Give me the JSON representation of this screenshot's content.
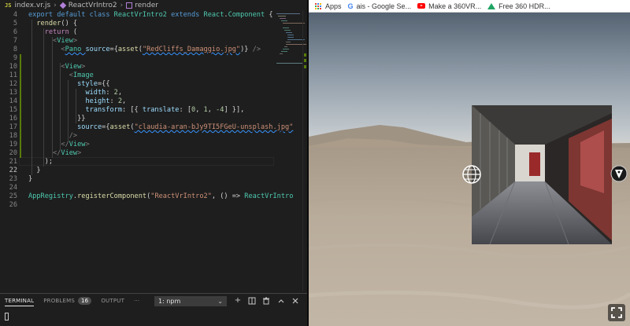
{
  "editor": {
    "breadcrumb": {
      "file_badge": "JS",
      "file_name": "index.vr.js",
      "class_name": "ReactVrIntro2",
      "method_name": "render",
      "separator": "›"
    },
    "lines": [
      {
        "num": "4",
        "tokens": [
          [
            "kw",
            "export "
          ],
          [
            "kw",
            "default "
          ],
          [
            "kw",
            "class "
          ],
          [
            "cls",
            "ReactVrIntro2 "
          ],
          [
            "kw",
            "extends "
          ],
          [
            "cls",
            "React"
          ],
          [
            "txt",
            "."
          ],
          [
            "cls",
            "Component "
          ],
          [
            "txt",
            "{"
          ]
        ]
      },
      {
        "num": "5",
        "tokens": [
          [
            "txt",
            "  "
          ],
          [
            "fn",
            "render"
          ],
          [
            "txt",
            "() {"
          ]
        ]
      },
      {
        "num": "6",
        "tokens": [
          [
            "txt",
            "    "
          ],
          [
            "ctl",
            "return "
          ],
          [
            "txt",
            "("
          ]
        ]
      },
      {
        "num": "7",
        "tokens": [
          [
            "txt",
            "      "
          ],
          [
            "punc",
            "<"
          ],
          [
            "tag",
            "View"
          ],
          [
            "punc",
            ">"
          ]
        ]
      },
      {
        "num": "8",
        "tokens": [
          [
            "txt",
            "        "
          ],
          [
            "punc",
            "<"
          ],
          [
            "tag",
            "Pano "
          ],
          [
            "prop",
            "source"
          ],
          [
            "txt",
            "={"
          ],
          [
            "fn",
            "asset"
          ],
          [
            "txt",
            "("
          ],
          [
            "str",
            "\"RedCliffs_Damaggio.jpg\""
          ],
          [
            "txt",
            ")} "
          ],
          [
            "punc",
            "/>"
          ]
        ]
      },
      {
        "num": "9",
        "tokens": []
      },
      {
        "num": "10",
        "tokens": [
          [
            "txt",
            "        "
          ],
          [
            "punc",
            "<"
          ],
          [
            "tag",
            "View"
          ],
          [
            "punc",
            ">"
          ]
        ]
      },
      {
        "num": "11",
        "tokens": [
          [
            "txt",
            "          "
          ],
          [
            "punc",
            "<"
          ],
          [
            "tag",
            "Image"
          ]
        ]
      },
      {
        "num": "12",
        "tokens": [
          [
            "txt",
            "            "
          ],
          [
            "prop",
            "style"
          ],
          [
            "txt",
            "={{"
          ]
        ]
      },
      {
        "num": "13",
        "tokens": [
          [
            "txt",
            "              "
          ],
          [
            "prop",
            "width"
          ],
          [
            "txt",
            ": "
          ],
          [
            "num",
            "2"
          ],
          [
            "txt",
            ","
          ]
        ]
      },
      {
        "num": "14",
        "tokens": [
          [
            "txt",
            "              "
          ],
          [
            "prop",
            "height"
          ],
          [
            "txt",
            ": "
          ],
          [
            "num",
            "2"
          ],
          [
            "txt",
            ","
          ]
        ]
      },
      {
        "num": "15",
        "tokens": [
          [
            "txt",
            "              "
          ],
          [
            "prop",
            "transform"
          ],
          [
            "txt",
            ": [{ "
          ],
          [
            "prop",
            "translate"
          ],
          [
            "txt",
            ": ["
          ],
          [
            "num",
            "0"
          ],
          [
            "txt",
            ", "
          ],
          [
            "num",
            "1"
          ],
          [
            "txt",
            ", "
          ],
          [
            "num",
            "-4"
          ],
          [
            "txt",
            "] }],"
          ]
        ]
      },
      {
        "num": "16",
        "tokens": [
          [
            "txt",
            "            }}"
          ]
        ]
      },
      {
        "num": "17",
        "tokens": [
          [
            "txt",
            "            "
          ],
          [
            "prop",
            "source"
          ],
          [
            "txt",
            "={"
          ],
          [
            "fn",
            "asset"
          ],
          [
            "txt",
            "("
          ],
          [
            "str",
            "\"claudia-aran-bJy9TI5FGeU-unsplash.jpg\""
          ]
        ]
      },
      {
        "num": "18",
        "tokens": [
          [
            "txt",
            "          "
          ],
          [
            "punc",
            "/>"
          ]
        ]
      },
      {
        "num": "19",
        "tokens": [
          [
            "txt",
            "        "
          ],
          [
            "punc",
            "</"
          ],
          [
            "tag",
            "View"
          ],
          [
            "punc",
            ">"
          ]
        ]
      },
      {
        "num": "20",
        "tokens": [
          [
            "txt",
            "      "
          ],
          [
            "punc",
            "</"
          ],
          [
            "tag",
            "View"
          ],
          [
            "punc",
            ">"
          ]
        ]
      },
      {
        "num": "21",
        "tokens": [
          [
            "txt",
            "    );"
          ]
        ]
      },
      {
        "num": "22",
        "tokens": [
          [
            "txt",
            "  }"
          ]
        ]
      },
      {
        "num": "23",
        "tokens": [
          [
            "txt",
            "}"
          ]
        ]
      },
      {
        "num": "24",
        "tokens": []
      },
      {
        "num": "25",
        "tokens": [
          [
            "cls",
            "AppRegistry"
          ],
          [
            "txt",
            "."
          ],
          [
            "fn",
            "registerComponent"
          ],
          [
            "txt",
            "("
          ],
          [
            "str",
            "\"ReactVrIntro2\""
          ],
          [
            "txt",
            ", () => "
          ],
          [
            "cls",
            "ReactVrIntro"
          ]
        ]
      },
      {
        "num": "26",
        "tokens": []
      }
    ]
  },
  "panel": {
    "tabs": [
      {
        "label": "TERMINAL",
        "active": true
      },
      {
        "label": "PROBLEMS",
        "badge": "16",
        "active": false
      },
      {
        "label": "OUTPUT",
        "active": false
      },
      {
        "label": "···",
        "active": false
      }
    ],
    "terminal_select": "1: npm",
    "icons": [
      "plus-icon",
      "split-icon",
      "trash-icon",
      "chevron-up-icon",
      "close-icon"
    ]
  },
  "browser": {
    "bookmarks": [
      {
        "icon": "apps-icon",
        "label": "Apps"
      },
      {
        "icon": "google-icon",
        "label": "ais - Google Se..."
      },
      {
        "icon": "youtube-icon",
        "label": "Make a 360VR..."
      },
      {
        "icon": "drive-icon",
        "label": "Free 360 HDR..."
      }
    ]
  },
  "colors": {
    "editor_bg": "#1e1e1e",
    "sky_top": "#546373",
    "sky_horizon": "#c0c6cb",
    "ground": "#b7aa99",
    "git_added": "#587c0c"
  }
}
